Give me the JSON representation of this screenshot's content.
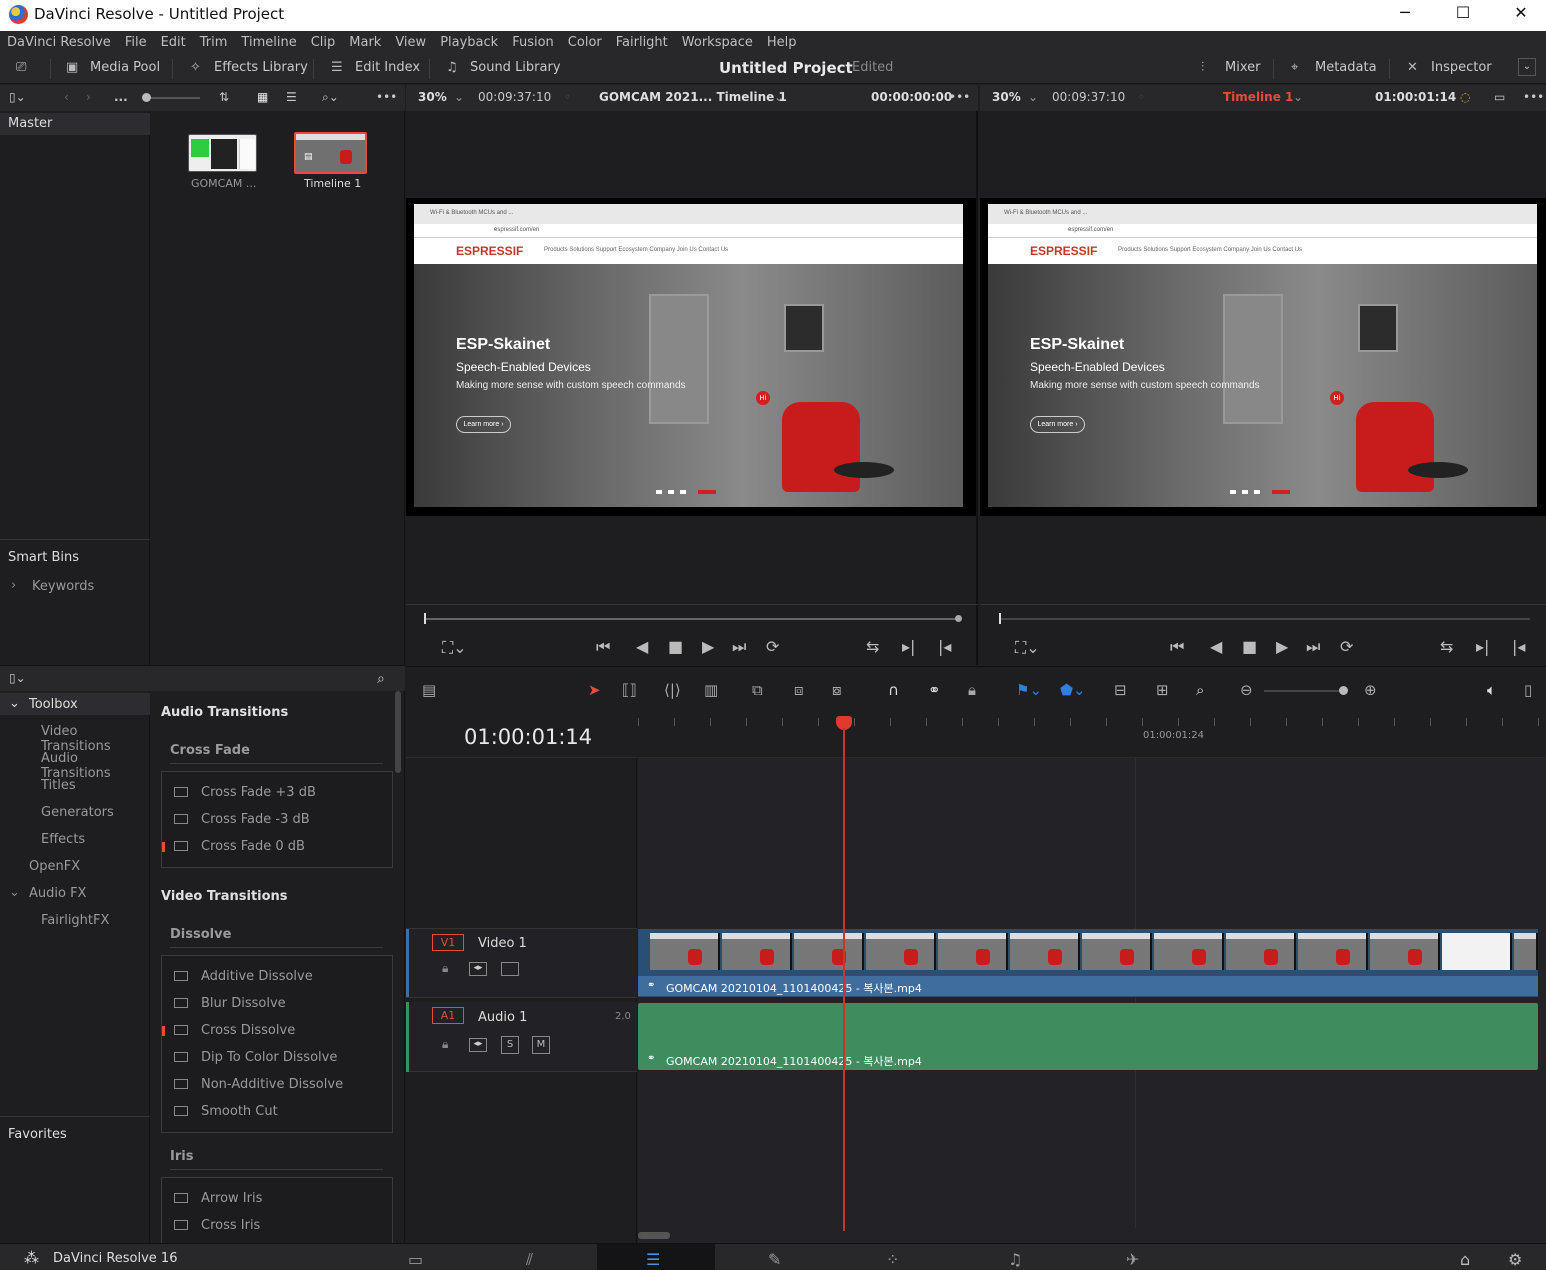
{
  "window": {
    "app_title": "DaVinci Resolve - Untitled Project",
    "minimize": "─",
    "maximize": "☐",
    "close": "✕"
  },
  "menu": [
    "DaVinci Resolve",
    "File",
    "Edit",
    "Trim",
    "Timeline",
    "Clip",
    "Mark",
    "View",
    "Playback",
    "Fusion",
    "Color",
    "Fairlight",
    "Workspace",
    "Help"
  ],
  "toolbar": {
    "media_pool": "Media Pool",
    "effects_library": "Effects Library",
    "edit_index": "Edit Index",
    "sound_library": "Sound Library",
    "project_title": "Untitled Project",
    "project_status": "Edited",
    "mixer": "Mixer",
    "metadata": "Metadata",
    "inspector": "Inspector"
  },
  "media_pool": {
    "more": "...",
    "bin_master": "Master",
    "clips": [
      {
        "name": "GOMCAM ..."
      },
      {
        "name": "Timeline 1"
      }
    ],
    "smart_bins": "Smart Bins",
    "keywords": "Keywords"
  },
  "source_viewer": {
    "zoom": "30%",
    "duration": "00:09:37:10",
    "clip_name": "GOMCAM 2021... Timeline 1",
    "timecode": "00:00:00:00"
  },
  "timeline_viewer": {
    "zoom": "30%",
    "duration": "00:09:37:10",
    "timeline_name": "Timeline 1",
    "timecode": "01:00:01:14"
  },
  "viewer_content": {
    "tab_title": "Wi-Fi & Bluetooth MCUs and ...",
    "url": "espressif.com/en",
    "brand": "ESPRESSIF",
    "nav_links": "Products   Solutions   Support   Ecosystem   Company   Join Us   Contact Us",
    "headline": "ESP-Skainet",
    "subheadline": "Speech-Enabled Devices",
    "tagline": "Making more sense with custom speech commands",
    "button": "Learn more ›",
    "badge": "Hi"
  },
  "effects": {
    "toolbox": "Toolbox",
    "tree": [
      "Video Transitions",
      "Audio Transitions",
      "Titles",
      "Generators",
      "Effects"
    ],
    "openfx": "OpenFX",
    "audio_fx": "Audio FX",
    "fairlight_fx": "FairlightFX",
    "favorites": "Favorites",
    "audio_transitions_title": "Audio Transitions",
    "cross_fade_group": "Cross Fade",
    "cross_fade_items": [
      "Cross Fade +3 dB",
      "Cross Fade -3 dB",
      "Cross Fade 0 dB"
    ],
    "video_transitions_title": "Video Transitions",
    "dissolve_group": "Dissolve",
    "dissolve_items": [
      "Additive Dissolve",
      "Blur Dissolve",
      "Cross Dissolve",
      "Dip To Color Dissolve",
      "Non-Additive Dissolve",
      "Smooth Cut"
    ],
    "iris_group": "Iris",
    "iris_items": [
      "Arrow Iris",
      "Cross Iris"
    ]
  },
  "timeline": {
    "timecode": "01:00:01:14",
    "ruler_label": "01:00:01:24",
    "video_track": {
      "id": "V1",
      "name": "Video 1",
      "clip": "GOMCAM 20210104_1101400425 - 복사본.mp4"
    },
    "audio_track": {
      "id": "A1",
      "name": "Audio 1",
      "channels": "2.0",
      "solo": "S",
      "mute": "M",
      "clip": "GOMCAM 20210104_1101400425 - 복사본.mp4"
    }
  },
  "statusbar": {
    "app_version": "DaVinci Resolve 16"
  },
  "colors": {
    "accent_red": "#e64b3c",
    "video_clip": "#3f6d9e",
    "audio_clip": "#3f8c5e",
    "playhead": "#e03a2f"
  }
}
